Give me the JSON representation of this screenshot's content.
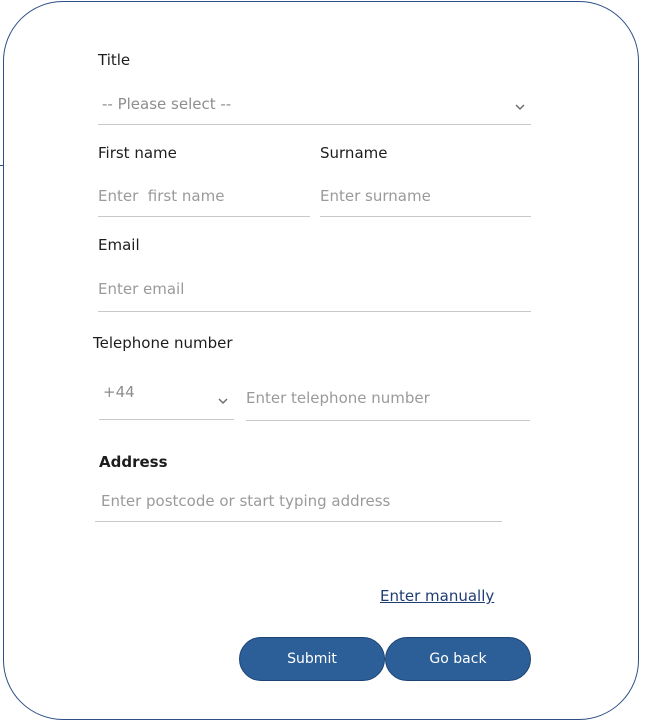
{
  "form": {
    "title_label": "Title",
    "title_select_value": "-- Please select --",
    "first_name_label": "First name",
    "first_name_placeholder": "Enter  first name",
    "surname_label": "Surname",
    "surname_placeholder": "Enter surname",
    "email_label": "Email",
    "email_placeholder": "Enter email",
    "telephone_label": "Telephone number",
    "country_code_value": "+44",
    "telephone_placeholder": "Enter telephone number",
    "address_label": "Address",
    "address_placeholder": "Enter postcode or start typing address",
    "enter_manually_link": "Enter manually",
    "submit_label": "Submit",
    "go_back_label": "Go back"
  },
  "icons": {
    "title_select": "chevron-down-icon",
    "country_code_select": "chevron-down-icon"
  },
  "colors": {
    "border": "#2c4f86",
    "button": "#2c5f98",
    "link": "#1f3d73"
  }
}
